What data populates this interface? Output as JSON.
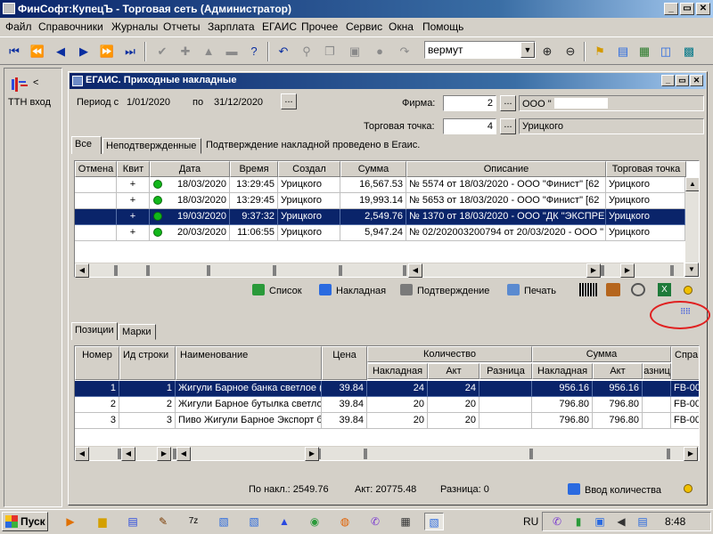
{
  "app": {
    "title": "ФинСофт:КупецЪ - Торговая сеть  (Администратор)",
    "window_buttons": [
      "_",
      "▭",
      "✕"
    ]
  },
  "menu": [
    "Файл",
    "Справочники",
    "Журналы",
    "Отчеты",
    "Зарплата",
    "ЕГАИС",
    "Прочее",
    "Сервис",
    "Окна",
    "Помощь"
  ],
  "toolbar": {
    "search_value": "вермут"
  },
  "left_panel": {
    "label": "ТТН вход",
    "arrow": "<"
  },
  "window": {
    "title": "ЕГАИС. Приходные накладные",
    "buttons": [
      "_",
      "▭",
      "✕"
    ],
    "period_label": "Период с",
    "date_from": "1/01/2020",
    "to_label": "по",
    "date_to": "31/12/2020",
    "dots": "...",
    "firm_label": "Фирма:",
    "firm_value": "2",
    "firm_name": "ООО \"",
    "point_label": "Торговая точка:",
    "point_value": "4",
    "point_name": "Урицкого"
  },
  "tabs": {
    "all": "Все",
    "unconfirmed": "Неподтвержденные",
    "status": "Подтверждение накладной проведено в Егаис."
  },
  "top_grid": {
    "headers": [
      "Отмена",
      "Квит",
      "Дата",
      "Время",
      "Создал",
      "Сумма",
      "Описание",
      "Торговая точка"
    ],
    "rows": [
      {
        "cancel": "",
        "kvit": "+",
        "date": "18/03/2020",
        "time": "13:29:45",
        "by": "Урицкого",
        "sum": "16,567.53",
        "desc": "№ 5574 от 18/03/2020 - ООО \"Финист\" [62",
        "point": "Урицкого"
      },
      {
        "cancel": "",
        "kvit": "+",
        "date": "18/03/2020",
        "time": "13:29:45",
        "by": "Урицкого",
        "sum": "19,993.14",
        "desc": "№ 5653 от 18/03/2020 - ООО \"Финист\" [62",
        "point": "Урицкого"
      },
      {
        "cancel": "",
        "kvit": "+",
        "date": "19/03/2020",
        "time": "9:37:32",
        "by": "Урицкого",
        "sum": "2,549.76",
        "desc": "№ 1370 от 18/03/2020 - ООО \"ДК \"ЭКСПРЕ",
        "point": "Урицкого"
      },
      {
        "cancel": "",
        "kvit": "+",
        "date": "20/03/2020",
        "time": "11:06:55",
        "by": "Урицкого",
        "sum": "5,947.24",
        "desc": "№ 02/202003200794 от 20/03/2020 - ООО \"",
        "point": "Урицкого"
      }
    ],
    "selected_row": 2
  },
  "actions": {
    "list": "Список",
    "invoice": "Накладная",
    "confirm": "Подтверждение",
    "print": "Печать"
  },
  "bottom_tabs": {
    "positions": "Позиции",
    "marks": "Марки"
  },
  "bottom_grid": {
    "headers": {
      "num": "Номер",
      "line_id": "Ид строки",
      "name": "Наименование",
      "price": "Цена",
      "qty": "Количество",
      "qty_inv": "Накладная",
      "qty_act": "Акт",
      "qty_diff": "Разница",
      "sum": "Сумма",
      "sum_inv": "Накладная",
      "sum_act": "Акт",
      "sum_diff": "азниц",
      "ref": "Спра"
    },
    "rows": [
      {
        "num": "1",
        "id": "1",
        "name": "Жигули Барное банка светлое (",
        "price": "39.84",
        "q_inv": "24",
        "q_act": "24",
        "q_diff": "",
        "s_inv": "956.16",
        "s_act": "956.16",
        "s_diff": "",
        "ref": "FB-00"
      },
      {
        "num": "2",
        "id": "2",
        "name": "Жигули Барное бутылка светло",
        "price": "39.84",
        "q_inv": "20",
        "q_act": "20",
        "q_diff": "",
        "s_inv": "796.80",
        "s_act": "796.80",
        "s_diff": "",
        "ref": "FB-00"
      },
      {
        "num": "3",
        "id": "3",
        "name": "Пиво Жигули Барное Экспорт б",
        "price": "39.84",
        "q_inv": "20",
        "q_act": "20",
        "q_diff": "",
        "s_inv": "796.80",
        "s_act": "796.80",
        "s_diff": "",
        "ref": "FB-00"
      }
    ],
    "selected_row": 0
  },
  "footer": {
    "by_invoice": "По накл.: 2549.76",
    "by_act": "Акт:  20775.48",
    "diff": "Разница:  0",
    "enter_qty": "Ввод количества"
  },
  "taskbar": {
    "start": "Пуск",
    "lang": "RU",
    "time": "8:48"
  }
}
